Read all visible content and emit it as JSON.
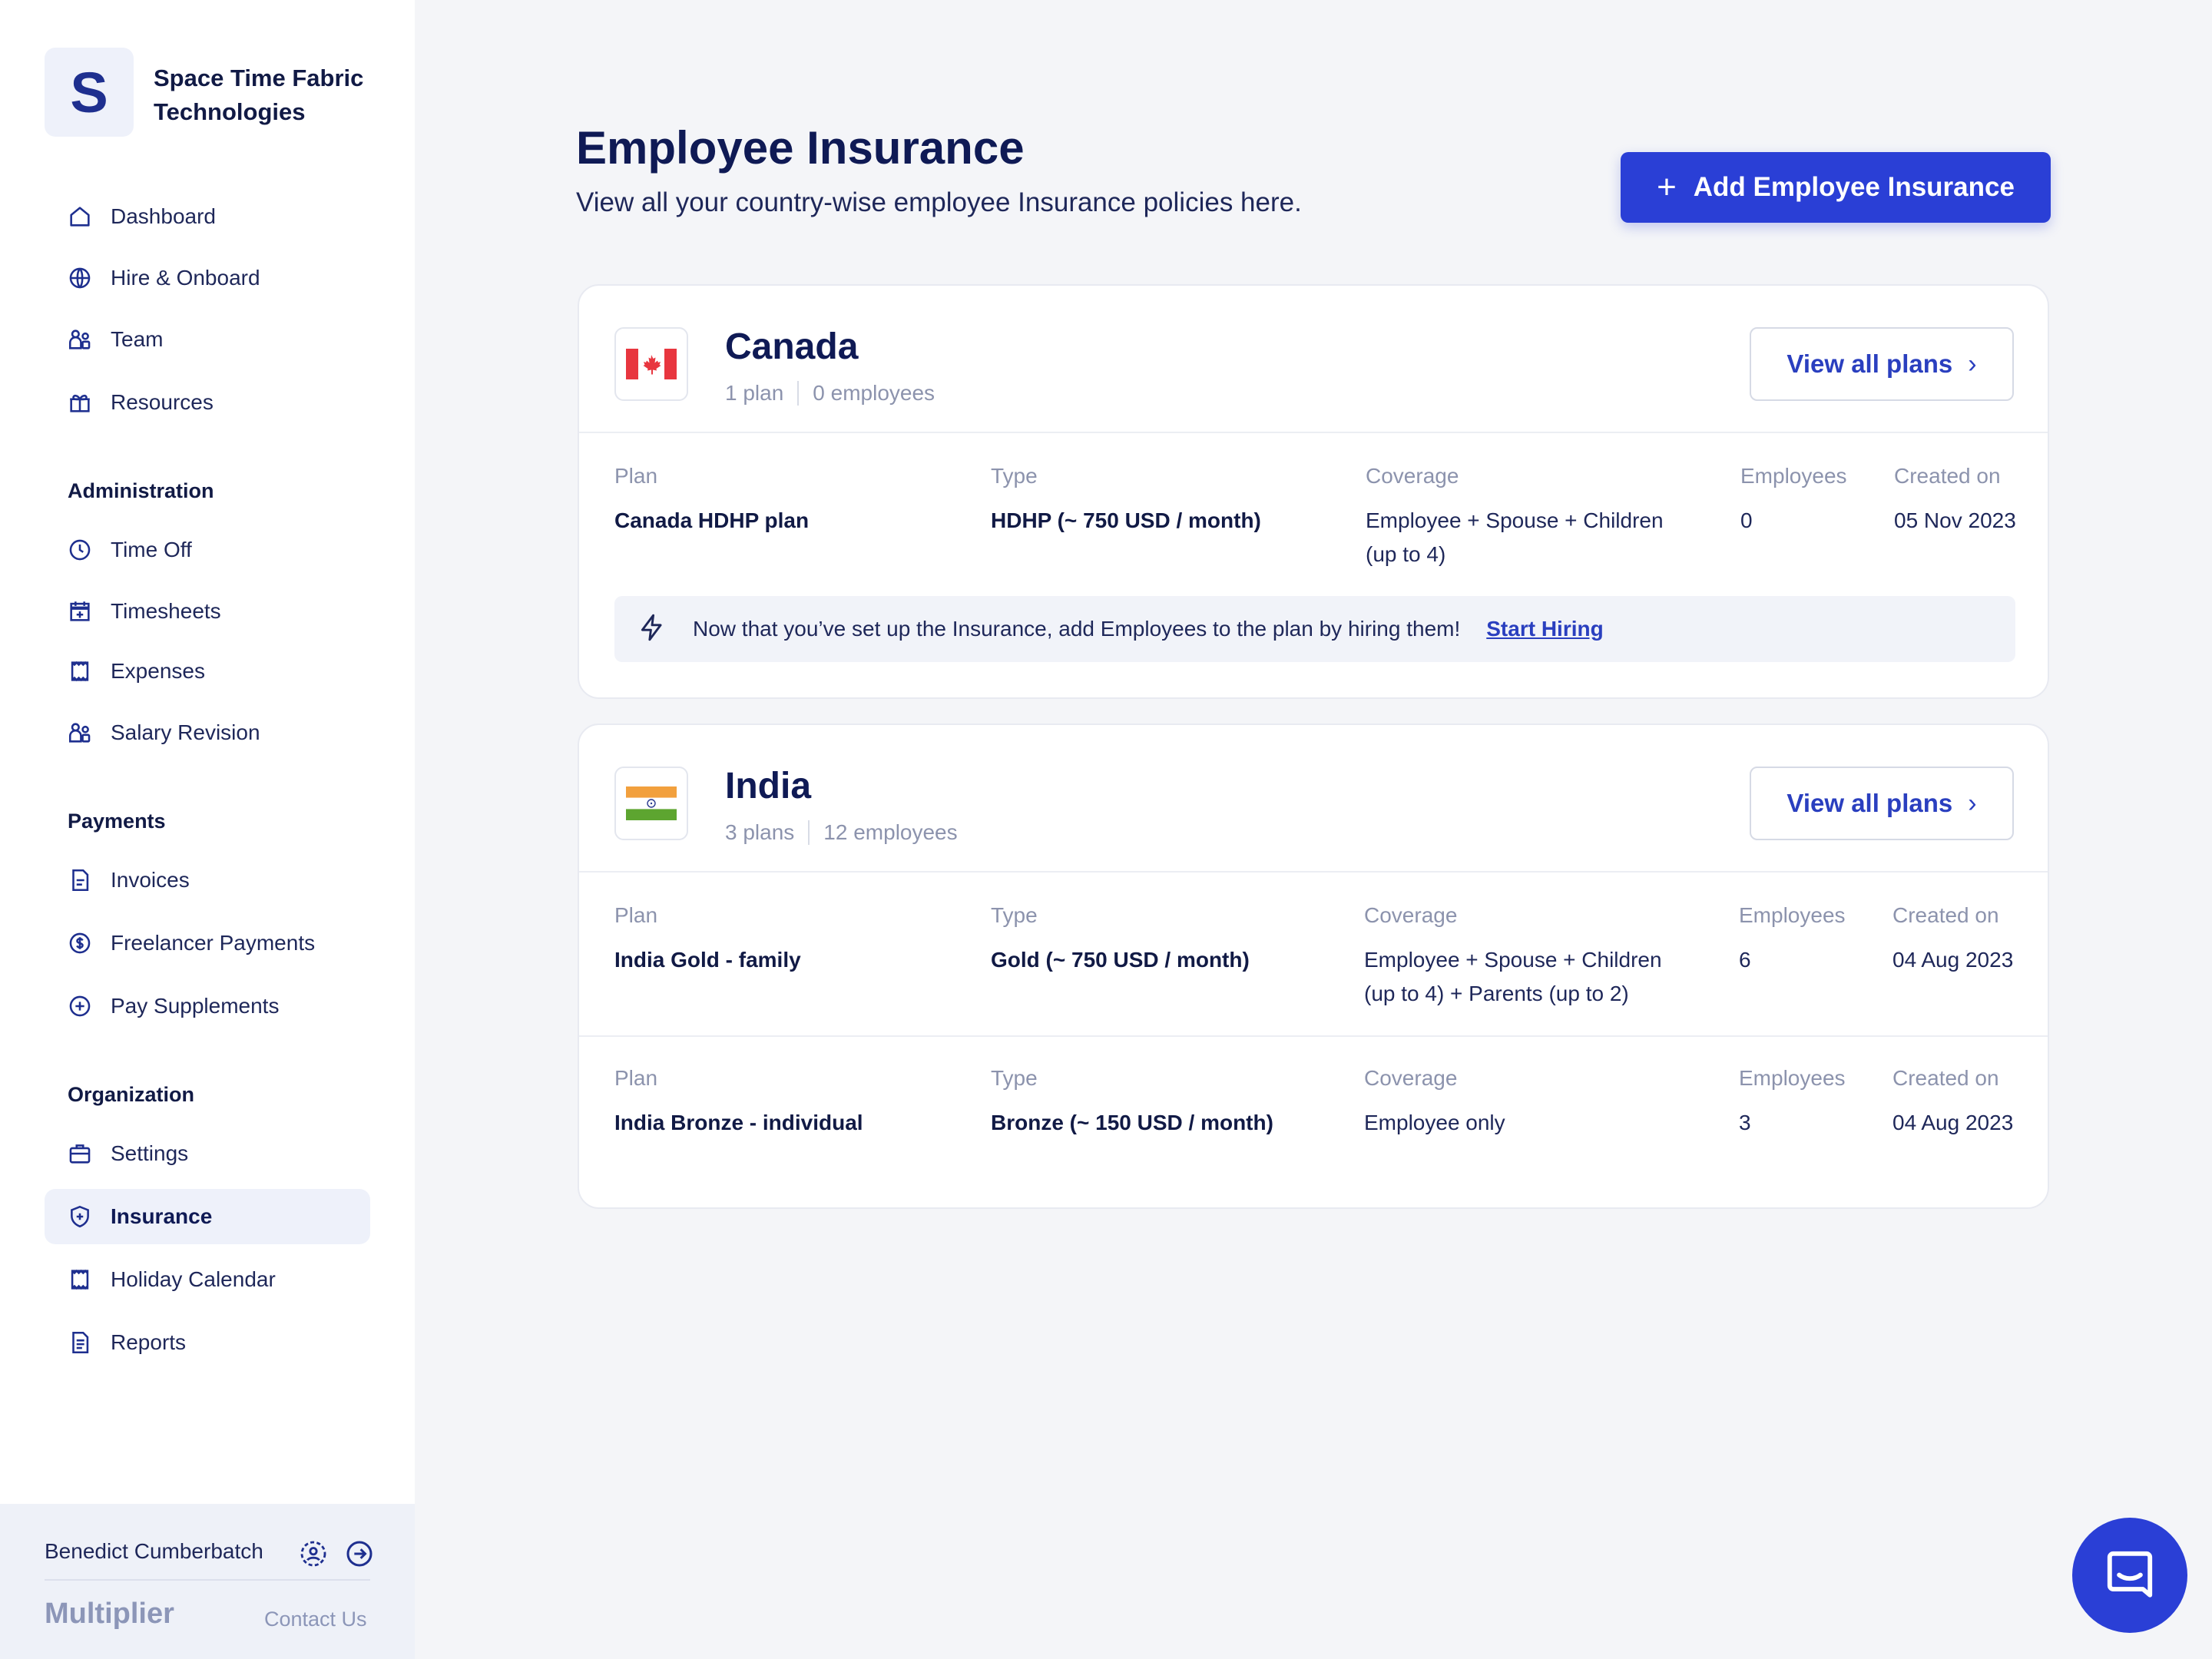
{
  "org": {
    "initial": "S",
    "name": "Space Time Fabric Technologies"
  },
  "nav": {
    "main": [
      {
        "label": "Dashboard",
        "icon": "home-icon"
      },
      {
        "label": "Hire & Onboard",
        "icon": "globe-icon"
      },
      {
        "label": "Team",
        "icon": "team-icon"
      },
      {
        "label": "Resources",
        "icon": "gift-icon"
      }
    ],
    "administration": {
      "title": "Administration",
      "items": [
        {
          "label": "Time Off",
          "icon": "clock-icon"
        },
        {
          "label": "Timesheets",
          "icon": "calendar-plus-icon"
        },
        {
          "label": "Expenses",
          "icon": "receipt-icon"
        },
        {
          "label": "Salary Revision",
          "icon": "team-icon"
        }
      ]
    },
    "payments": {
      "title": "Payments",
      "items": [
        {
          "label": "Invoices",
          "icon": "invoice-icon"
        },
        {
          "label": "Freelancer Payments",
          "icon": "dollar-circle-icon"
        },
        {
          "label": "Pay Supplements",
          "icon": "plus-circle-icon"
        }
      ]
    },
    "organization": {
      "title": "Organization",
      "items": [
        {
          "label": "Settings",
          "icon": "briefcase-icon"
        },
        {
          "label": "Insurance",
          "icon": "shield-icon",
          "active": true
        },
        {
          "label": "Holiday Calendar",
          "icon": "calendar-icon"
        },
        {
          "label": "Reports",
          "icon": "document-icon"
        }
      ]
    }
  },
  "user": {
    "name": "Benedict Cumberbatch"
  },
  "footer": {
    "brand": "Multiplier",
    "contact": "Contact Us"
  },
  "page": {
    "title": "Employee Insurance",
    "subtitle": "View all your country-wise employee Insurance policies here.",
    "add_button": "Add Employee Insurance"
  },
  "columns": {
    "plan": "Plan",
    "type": "Type",
    "coverage": "Coverage",
    "employees": "Employees",
    "created": "Created on"
  },
  "countries": [
    {
      "name": "Canada",
      "plans_count": "1 plan",
      "employees_count": "0 employees",
      "view_button": "View all plans",
      "plans": [
        {
          "plan": "Canada HDHP plan",
          "type": "HDHP (~ 750 USD / month)",
          "coverage_l1": "Employee + Spouse + Children",
          "coverage_l2": "(up to 4)",
          "employees": "0",
          "created": "05 Nov 2023"
        }
      ],
      "notice": {
        "text": "Now that you’ve set up the Insurance, add Employees to the plan by hiring them!",
        "link": "Start Hiring"
      }
    },
    {
      "name": "India",
      "plans_count": "3 plans",
      "employees_count": "12 employees",
      "view_button": "View all plans",
      "plans": [
        {
          "plan": "India Gold - family",
          "type": "Gold (~ 750 USD / month)",
          "coverage_l1": "Employee + Spouse + Children",
          "coverage_l2": "(up to 4) + Parents (up to 2)",
          "employees": "6",
          "created": "04 Aug 2023"
        },
        {
          "plan": "India Bronze - individual",
          "type": "Bronze (~ 150 USD / month)",
          "coverage_l1": "Employee only",
          "coverage_l2": "",
          "employees": "3",
          "created": "04 Aug 2023"
        }
      ]
    }
  ],
  "colors": {
    "primary": "#2A3FD6",
    "active_bg": "#EEF1FA",
    "page_bg": "#F4F5F8"
  }
}
